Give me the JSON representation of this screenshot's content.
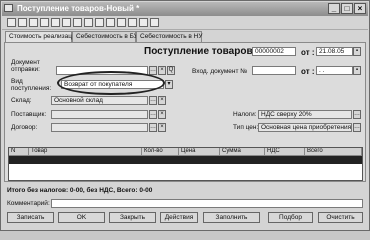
{
  "window": {
    "title": "Поступление товаров-Новый *"
  },
  "tabs": [
    {
      "label": "Стоимость реализации"
    },
    {
      "label": "Себестоимость в БУ"
    },
    {
      "label": "Себестоимость в НУ"
    }
  ],
  "header": {
    "doc_title": "Поступление товаров №",
    "doc_number": "00000002",
    "from_label": "от :",
    "doc_date": "21.08.05",
    "incoming_label": "Вход. документ №",
    "incoming_number": "",
    "incoming_from_label": "от :",
    "incoming_date": ". ."
  },
  "form": {
    "doc_sender_label": "Документ отправки:",
    "doc_sender_value": "",
    "receipt_type_label": "Вид поступления:",
    "receipt_type_value": "Возврат от покупателя",
    "warehouse_label": "Склад:",
    "warehouse_value": "Основной склад",
    "supplier_label": "Поставщик:",
    "supplier_value": "",
    "contract_label": "Договор:",
    "contract_value": "",
    "taxes_label": "Налоги:",
    "taxes_value": "НДС сверху 20%",
    "price_type_label": "Тип цен:",
    "price_type_value": "Основная цена приобретения"
  },
  "table": {
    "columns": [
      "N",
      "Товар",
      "Кол-во",
      "Цена",
      "Сумма",
      "НДС",
      "Всего"
    ]
  },
  "totals": {
    "text": "Итого без налогов: 0-00, без НДС, Всего: 0-00"
  },
  "comment": {
    "label": "Комментарий:",
    "value": ""
  },
  "buttons": {
    "write": "Записать",
    "ok": "OK",
    "close": "Закрыть",
    "actions": "Действия",
    "fill": "Заполнить",
    "selection": "Подбор",
    "clear": "Очистить"
  }
}
